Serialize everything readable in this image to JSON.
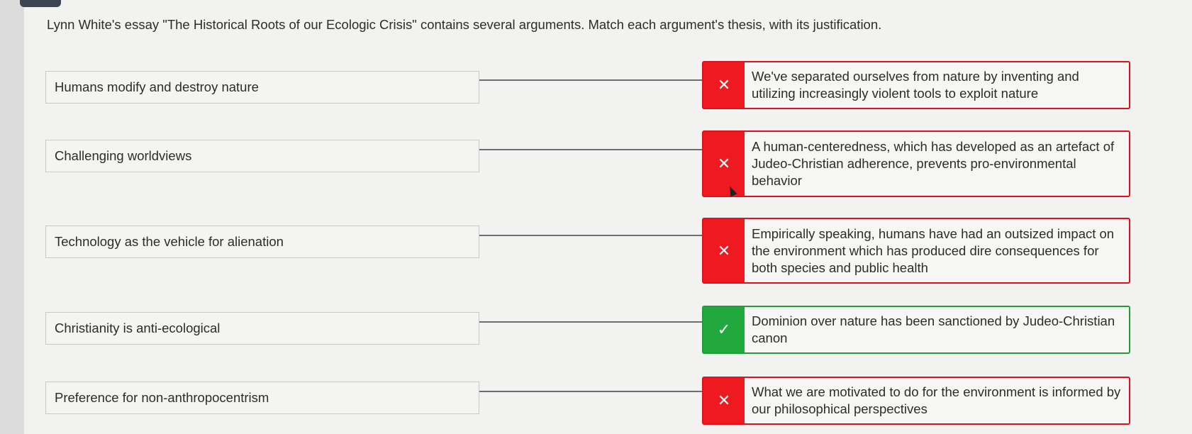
{
  "question": "Lynn White's essay \"The Historical Roots of our Ecologic Crisis\" contains several arguments. Match each argument's thesis, with its justification.",
  "pairs": [
    {
      "thesis": "Humans modify and destroy nature",
      "justification": "We've separated ourselves from nature by inventing and utilizing increasingly violent tools to exploit nature",
      "status_icon": "✕",
      "status": "incorrect"
    },
    {
      "thesis": "Challenging worldviews",
      "justification": "A human-centeredness, which has developed as an artefact of Judeo-Christian adherence, prevents pro-environmental behavior",
      "status_icon": "✕",
      "status": "incorrect"
    },
    {
      "thesis": "Technology as the vehicle for alienation",
      "justification": "Empirically speaking, humans have had an outsized impact on the environment which has produced dire consequences for both species and public health",
      "status_icon": "✕",
      "status": "incorrect"
    },
    {
      "thesis": "Christianity is anti-ecological",
      "justification": "Dominion over nature has been sanctioned by Judeo-Christian canon",
      "status_icon": "✓",
      "status": "correct"
    },
    {
      "thesis": "Preference for non-anthropocentrism",
      "justification": "What we are motivated to do for the environment is informed by our philosophical perspectives",
      "status_icon": "✕",
      "status": "incorrect"
    }
  ],
  "colors": {
    "incorrect": "#ee1a1f",
    "correct": "#22a93e"
  }
}
